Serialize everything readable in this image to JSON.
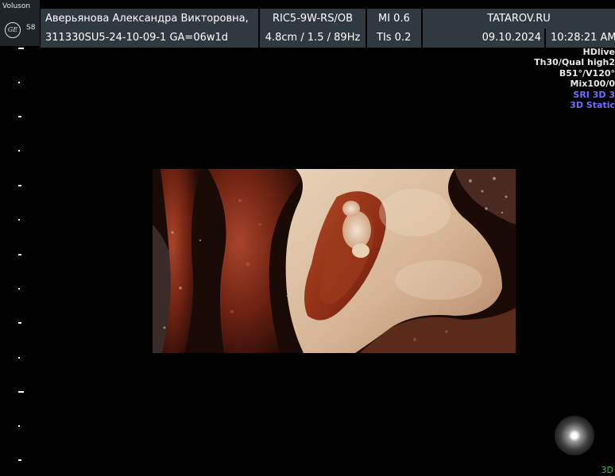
{
  "logo": {
    "brand": "Voluson",
    "ge_mark": "GE",
    "model": "S8"
  },
  "header": {
    "patient_name": "Аверьянова Александра Викторовна,",
    "probe": "RIC5-9W-RS/OB",
    "mi": "MI  0.6",
    "clinic": "TATAROV.RU",
    "patient_id": "311330SU5-24-10-09-1  GA=06w1d",
    "depth_params": "4.8cm / 1.5 / 89Hz",
    "tis": "TIs  0.2",
    "date": "09.10.2024",
    "time": "10:28:21 AM"
  },
  "render_info": {
    "line1": "HDlive",
    "line2": "Th30/Qual high2",
    "line3": "B51°/V120°",
    "line4": "Mix100/0",
    "line5": "SRI 3D 3",
    "line6": "3D Static"
  },
  "mode_indicator": "3D",
  "colors": {
    "header_bg": "#2f3a40",
    "logo_bg": "#1e2428",
    "info_blue": "#6e6eff",
    "mode_green": "#3bbd3b",
    "tissue_light": "#dcc0a4",
    "tissue_red": "#8a2a14"
  }
}
